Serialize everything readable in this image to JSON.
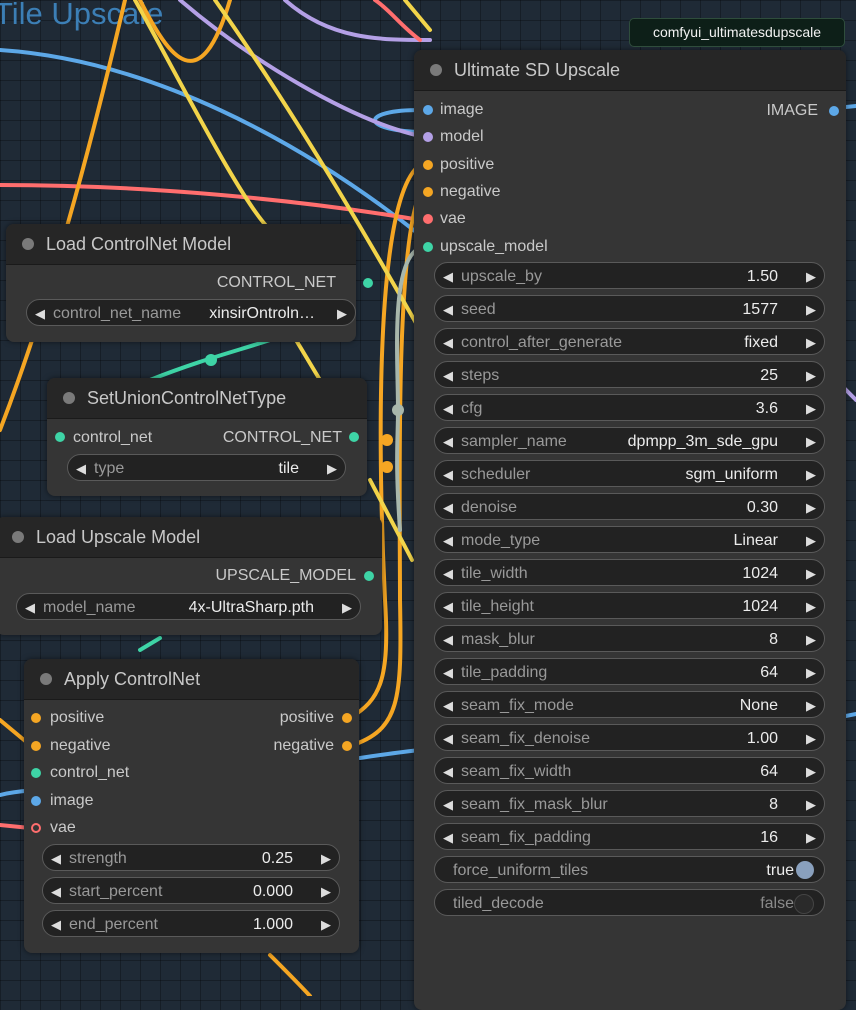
{
  "group_title": "Tile Upscale",
  "badge": "comfyui_ultimatesdupscale",
  "colors": {
    "image": "#5da8e8",
    "model": "#b4a0e6",
    "clip_cond": "#f5a623",
    "vae": "#ff6e6e",
    "upscale_model": "#a8b7ac",
    "control_net": "#3ed4a6",
    "yellow_wire": "#f2d44a",
    "node_bg": "#353535",
    "node_header": "#262626"
  },
  "ultimate": {
    "title": "Ultimate SD Upscale",
    "inputs": [
      "image",
      "model",
      "positive",
      "negative",
      "vae",
      "upscale_model"
    ],
    "output": "IMAGE",
    "widgets": [
      {
        "name": "upscale_by",
        "value": "1.50"
      },
      {
        "name": "seed",
        "value": "1577"
      },
      {
        "name": "control_after_generate",
        "value": "fixed"
      },
      {
        "name": "steps",
        "value": "25"
      },
      {
        "name": "cfg",
        "value": "3.6"
      },
      {
        "name": "sampler_name",
        "value": "dpmpp_3m_sde_gpu"
      },
      {
        "name": "scheduler",
        "value": "sgm_uniform"
      },
      {
        "name": "denoise",
        "value": "0.30"
      },
      {
        "name": "mode_type",
        "value": "Linear"
      },
      {
        "name": "tile_width",
        "value": "1024"
      },
      {
        "name": "tile_height",
        "value": "1024"
      },
      {
        "name": "mask_blur",
        "value": "8"
      },
      {
        "name": "tile_padding",
        "value": "64"
      },
      {
        "name": "seam_fix_mode",
        "value": "None"
      },
      {
        "name": "seam_fix_denoise",
        "value": "1.00"
      },
      {
        "name": "seam_fix_width",
        "value": "64"
      },
      {
        "name": "seam_fix_mask_blur",
        "value": "8"
      },
      {
        "name": "seam_fix_padding",
        "value": "16"
      }
    ],
    "toggles": [
      {
        "name": "force_uniform_tiles",
        "value": "true"
      },
      {
        "name": "tiled_decode",
        "value": "false"
      }
    ]
  },
  "load_controlnet": {
    "title": "Load ControlNet Model",
    "output": "CONTROL_NET",
    "widget": {
      "name": "control_net_name",
      "value": "xinsirOntroln…"
    }
  },
  "set_union": {
    "title": "SetUnionControlNetType",
    "input": "control_net",
    "output": "CONTROL_NET",
    "widget": {
      "name": "type",
      "value": "tile"
    }
  },
  "load_upscale": {
    "title": "Load Upscale Model",
    "output": "UPSCALE_MODEL",
    "widget": {
      "name": "model_name",
      "value": "4x-UltraSharp.pth"
    }
  },
  "apply_controlnet": {
    "title": "Apply ControlNet",
    "inputs": [
      "positive",
      "negative",
      "control_net",
      "image",
      "vae"
    ],
    "outputs": [
      "positive",
      "negative"
    ],
    "widgets": [
      {
        "name": "strength",
        "value": "0.25"
      },
      {
        "name": "start_percent",
        "value": "0.000"
      },
      {
        "name": "end_percent",
        "value": "1.000"
      }
    ]
  }
}
